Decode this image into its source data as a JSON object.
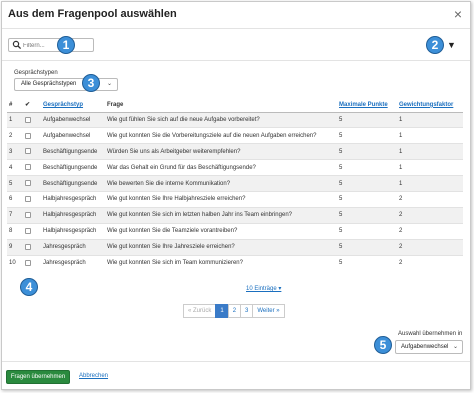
{
  "dialog": {
    "title": "Aus dem Fragenpool auswählen",
    "close": "×"
  },
  "search": {
    "placeholder": "Filtern..."
  },
  "filter_toggle": "▼",
  "type_filter": {
    "label": "Gesprächstypen",
    "value": "Alle Gesprächstypen"
  },
  "callouts": [
    "1",
    "2",
    "3",
    "4",
    "5"
  ],
  "table": {
    "headers": {
      "num": "#",
      "check": "✔",
      "type": "Gesprächstyp",
      "question": "Frage",
      "max_points": "Maximale Punkte",
      "weight": "Gewichtungsfaktor"
    },
    "rows": [
      {
        "num": "1",
        "type": "Aufgabenwechsel",
        "question": "Wie gut fühlen Sie sich auf die neue Aufgabe vorbereitet?",
        "max_points": "5",
        "weight": "1"
      },
      {
        "num": "2",
        "type": "Aufgabenwechsel",
        "question": "Wie gut konnten Sie die Vorbereitungsziele auf die neuen Aufgaben erreichen?",
        "max_points": "5",
        "weight": "1"
      },
      {
        "num": "3",
        "type": "Beschäftigungsende",
        "question": "Würden Sie uns als Arbeitgeber weiterempfehlen?",
        "max_points": "5",
        "weight": "1"
      },
      {
        "num": "4",
        "type": "Beschäftigungsende",
        "question": "War das Gehalt ein Grund für das Beschäftigungsende?",
        "max_points": "5",
        "weight": "1"
      },
      {
        "num": "5",
        "type": "Beschäftigungsende",
        "question": "Wie bewerten Sie die interne Kommunikation?",
        "max_points": "5",
        "weight": "1"
      },
      {
        "num": "6",
        "type": "Halbjahresgespräch",
        "question": "Wie gut konnten Sie Ihre Halbjahresziele erreichen?",
        "max_points": "5",
        "weight": "2"
      },
      {
        "num": "7",
        "type": "Halbjahresgespräch",
        "question": "Wie gut konnten Sie sich im letzten halben Jahr ins Team einbringen?",
        "max_points": "5",
        "weight": "2"
      },
      {
        "num": "8",
        "type": "Halbjahresgespräch",
        "question": "Wie gut konnten Sie die Teamziele vorantreiben?",
        "max_points": "5",
        "weight": "2"
      },
      {
        "num": "9",
        "type": "Jahresgespräch",
        "question": "Wie gut konnten Sie Ihre Jahresziele erreichen?",
        "max_points": "5",
        "weight": "2"
      },
      {
        "num": "10",
        "type": "Jahresgespräch",
        "question": "Wie gut konnten Sie sich im Team kommunizieren?",
        "max_points": "5",
        "weight": "2"
      }
    ]
  },
  "entries_selector": "10 Einträge ▾",
  "pagination": {
    "prev": "« Zurück",
    "pages": [
      "1",
      "2",
      "3"
    ],
    "next": "Weiter »"
  },
  "apply_target": {
    "label": "Auswahl übernehmen in",
    "value": "Aufgabenwechsel"
  },
  "footer": {
    "primary": "Fragen übernehmen",
    "cancel": "Abbrechen"
  },
  "colors": {
    "callout": "#3c8fd8",
    "primary": "#2a8a3e",
    "link": "#1a6fbf",
    "active_page": "#3a7bc8"
  }
}
